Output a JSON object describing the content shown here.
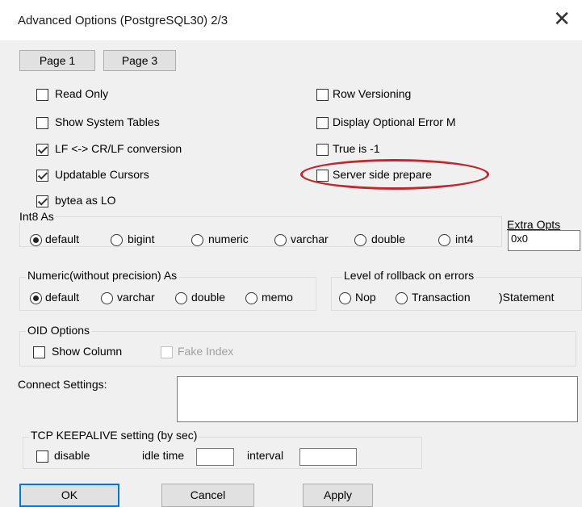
{
  "window": {
    "title": "Advanced Options (PostgreSQL30) 2/3",
    "close_glyph": "✕"
  },
  "nav": {
    "page1_label": "Page 1",
    "page3_label": "Page 3"
  },
  "checkboxes": {
    "read_only": {
      "label": "Read Only",
      "checked": false
    },
    "show_system_tables": {
      "label": "Show System Tables",
      "checked": false
    },
    "lf_conversion": {
      "label": "LF <-> CR/LF conversion",
      "checked": true
    },
    "updatable_cursors": {
      "label": "Updatable Cursors",
      "checked": true
    },
    "bytea_as_lo": {
      "label": "bytea as LO",
      "checked": true
    },
    "row_versioning": {
      "label": "Row Versioning",
      "checked": false
    },
    "display_optional_error": {
      "label": "Display Optional Error M",
      "checked": false
    },
    "true_is_minus1": {
      "label": "True is -1",
      "checked": false
    },
    "server_side_prepare": {
      "label": "Server side prepare",
      "checked": false
    }
  },
  "int8_as": {
    "title": "Int8 As",
    "options": [
      "default",
      "bigint",
      "numeric",
      "varchar",
      "double",
      "int4"
    ],
    "selected": "default"
  },
  "extra_opts": {
    "label": "Extra Opts",
    "value": "0x0"
  },
  "numeric_as": {
    "title": "Numeric(without precision) As",
    "options": [
      "default",
      "varchar",
      "double",
      "memo"
    ],
    "selected": "default"
  },
  "rollback": {
    "title": "Level of rollback on errors",
    "options": [
      "Nop",
      "Transaction",
      ")Statement"
    ]
  },
  "oid": {
    "title": "OID Options",
    "show_column_label": "Show Column",
    "fake_index_label": "Fake Index"
  },
  "connect_settings": {
    "label": "Connect Settings:",
    "value": ""
  },
  "keepalive": {
    "title": "TCP KEEPALIVE setting (by sec)",
    "disable_label": "disable",
    "idle_label": "idle time",
    "interval_label": "interval",
    "idle_value": "",
    "interval_value": ""
  },
  "buttons": {
    "ok": "OK",
    "cancel": "Cancel",
    "apply": "Apply"
  },
  "colors": {
    "highlight_ellipse": "#c0282d",
    "default_button_border": "#0078d7"
  }
}
